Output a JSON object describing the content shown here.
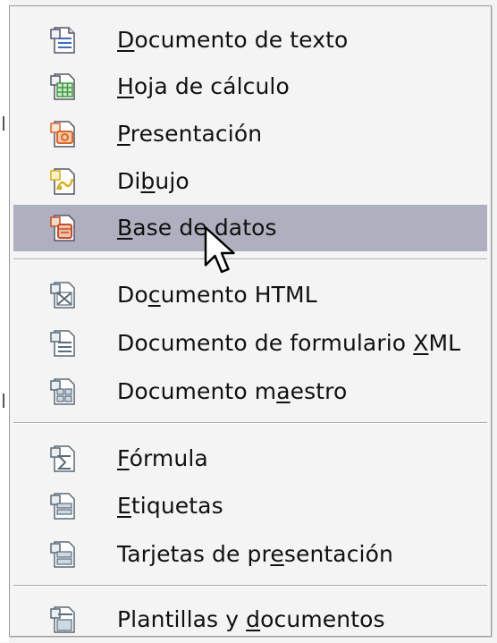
{
  "menu": {
    "group1": [
      {
        "label": "Documento de texto",
        "icon": "text-document-icon",
        "accent": "#3a6fb0"
      },
      {
        "label": "Hoja de cálculo",
        "icon": "spreadsheet-icon",
        "accent": "#3e9a3e"
      },
      {
        "label": "Presentación",
        "icon": "presentation-icon",
        "accent": "#d9662a"
      },
      {
        "label": "Dibujo",
        "icon": "drawing-icon",
        "accent": "#d8b020"
      },
      {
        "label": "Base de datos",
        "icon": "database-icon",
        "accent": "#c0502a",
        "highlighted": true
      }
    ],
    "group2": [
      {
        "label": "Documento HTML",
        "icon": "html-document-icon"
      },
      {
        "label": "Documento de formulario XML",
        "icon": "xml-form-document-icon"
      },
      {
        "label": "Documento maestro",
        "icon": "master-document-icon"
      }
    ],
    "group3": [
      {
        "label": "Fórmula",
        "icon": "formula-icon"
      },
      {
        "label": "Etiquetas",
        "icon": "labels-icon"
      },
      {
        "label": "Tarjetas de presentación",
        "icon": "business-cards-icon"
      }
    ],
    "group4": [
      {
        "label": "Plantillas y documentos",
        "icon": "templates-documents-icon"
      }
    ]
  },
  "colors": {
    "highlight": "#aeb0bf",
    "menu_background": "#f4f4f4",
    "icon_gray": "#5a6a78"
  }
}
